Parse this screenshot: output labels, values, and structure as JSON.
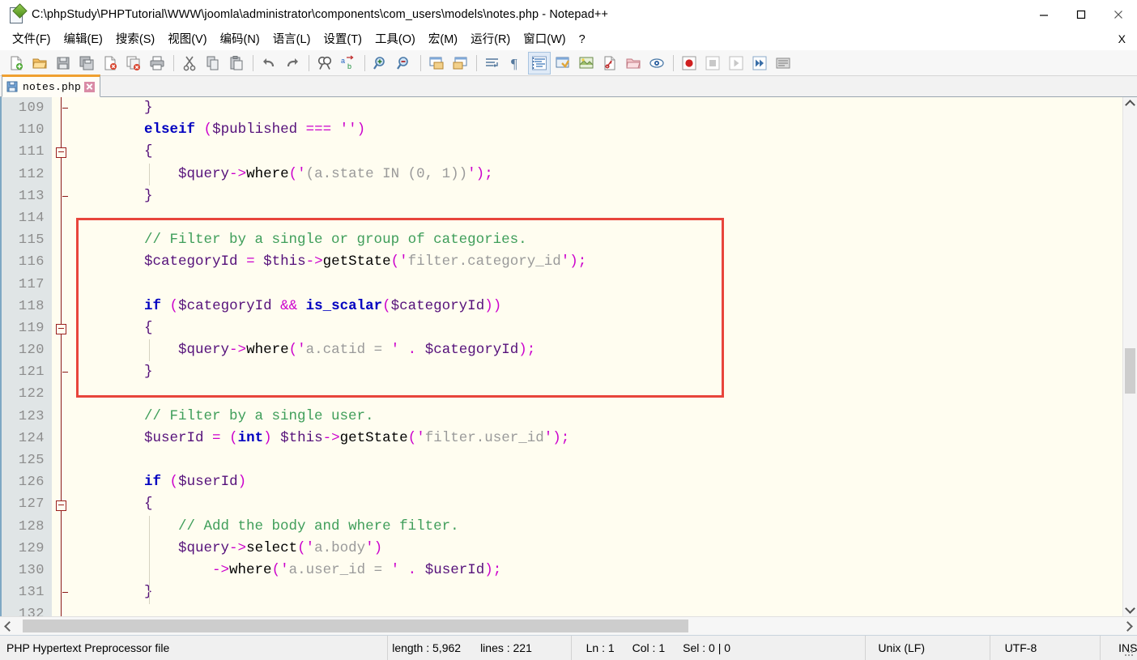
{
  "window": {
    "title": "C:\\phpStudy\\PHPTutorial\\WWW\\joomla\\administrator\\components\\com_users\\models\\notes.php - Notepad++",
    "icon": "notepadpp-document-icon",
    "controls": {
      "minimize": "minimize-icon",
      "maximize": "maximize-icon",
      "close": "close-icon"
    }
  },
  "menubar": {
    "items": [
      {
        "label": "文件(F)",
        "name": "menu-file"
      },
      {
        "label": "编辑(E)",
        "name": "menu-edit"
      },
      {
        "label": "搜索(S)",
        "name": "menu-search"
      },
      {
        "label": "视图(V)",
        "name": "menu-view"
      },
      {
        "label": "编码(N)",
        "name": "menu-encoding"
      },
      {
        "label": "语言(L)",
        "name": "menu-language"
      },
      {
        "label": "设置(T)",
        "name": "menu-settings"
      },
      {
        "label": "工具(O)",
        "name": "menu-tools"
      },
      {
        "label": "宏(M)",
        "name": "menu-macro"
      },
      {
        "label": "运行(R)",
        "name": "menu-run"
      },
      {
        "label": "窗口(W)",
        "name": "menu-window"
      },
      {
        "label": "?",
        "name": "menu-help"
      }
    ],
    "close_document": "X"
  },
  "toolbar": {
    "buttons": [
      "new-file-icon",
      "open-file-icon",
      "save-icon",
      "save-all-icon",
      "close-file-icon",
      "close-all-icon",
      "print-icon",
      "cut-icon",
      "copy-icon",
      "paste-icon",
      "undo-icon",
      "redo-icon",
      "find-icon",
      "replace-icon",
      "zoom-in-icon",
      "zoom-out-icon",
      "sync-vertical-scroll-icon",
      "sync-horizontal-scroll-icon",
      "word-wrap-icon",
      "show-all-chars-icon",
      "indent-guide-icon",
      "user-defined-dialog-icon",
      "show-doc-map-icon",
      "function-list-icon",
      "folder-as-workspace-icon",
      "monitoring-icon",
      "macro-record-icon",
      "macro-stop-icon",
      "macro-play-icon",
      "macro-run-multiple-icon",
      "macro-save-icon"
    ]
  },
  "tabs": [
    {
      "label": "notes.php",
      "icon": "saved-file-icon",
      "close": "tab-close-icon",
      "active": true
    }
  ],
  "editor": {
    "first_line": 109,
    "lines": [
      {
        "n": 109,
        "fold": "end",
        "tokens": [
          {
            "t": "        ",
            "c": "n"
          },
          {
            "t": "}",
            "c": "v"
          }
        ]
      },
      {
        "n": 110,
        "fold": "",
        "tokens": [
          {
            "t": "        ",
            "c": "n"
          },
          {
            "t": "elseif",
            "c": "k"
          },
          {
            "t": " ",
            "c": "n"
          },
          {
            "t": "(",
            "c": "p"
          },
          {
            "t": "$published",
            "c": "v"
          },
          {
            "t": " ",
            "c": "n"
          },
          {
            "t": "===",
            "c": "p"
          },
          {
            "t": " ",
            "c": "n"
          },
          {
            "t": "''",
            "c": "p"
          },
          {
            "t": ")",
            "c": "p"
          }
        ]
      },
      {
        "n": 111,
        "fold": "box",
        "tokens": [
          {
            "t": "        ",
            "c": "n"
          },
          {
            "t": "{",
            "c": "v"
          }
        ]
      },
      {
        "n": 112,
        "fold": "",
        "tokens": [
          {
            "t": "            ",
            "c": "n"
          },
          {
            "t": "$query",
            "c": "v"
          },
          {
            "t": "->",
            "c": "p"
          },
          {
            "t": "where",
            "c": "fn"
          },
          {
            "t": "(",
            "c": "p"
          },
          {
            "t": "'",
            "c": "p"
          },
          {
            "t": "(a.state IN (0, 1))",
            "c": "s"
          },
          {
            "t": "'",
            "c": "p"
          },
          {
            "t": ")",
            "c": "p"
          },
          {
            "t": ";",
            "c": "p"
          }
        ]
      },
      {
        "n": 113,
        "fold": "end",
        "tokens": [
          {
            "t": "        ",
            "c": "n"
          },
          {
            "t": "}",
            "c": "v"
          }
        ]
      },
      {
        "n": 114,
        "fold": "",
        "tokens": []
      },
      {
        "n": 115,
        "fold": "",
        "tokens": [
          {
            "t": "        ",
            "c": "n"
          },
          {
            "t": "// Filter by a single or group of categories.",
            "c": "c"
          }
        ]
      },
      {
        "n": 116,
        "fold": "",
        "tokens": [
          {
            "t": "        ",
            "c": "n"
          },
          {
            "t": "$categoryId",
            "c": "v"
          },
          {
            "t": " ",
            "c": "n"
          },
          {
            "t": "=",
            "c": "p"
          },
          {
            "t": " ",
            "c": "n"
          },
          {
            "t": "$this",
            "c": "v"
          },
          {
            "t": "->",
            "c": "p"
          },
          {
            "t": "getState",
            "c": "fn"
          },
          {
            "t": "(",
            "c": "p"
          },
          {
            "t": "'",
            "c": "p"
          },
          {
            "t": "filter.category_id",
            "c": "s"
          },
          {
            "t": "'",
            "c": "p"
          },
          {
            "t": ")",
            "c": "p"
          },
          {
            "t": ";",
            "c": "p"
          }
        ]
      },
      {
        "n": 117,
        "fold": "",
        "tokens": []
      },
      {
        "n": 118,
        "fold": "",
        "tokens": [
          {
            "t": "        ",
            "c": "n"
          },
          {
            "t": "if",
            "c": "k"
          },
          {
            "t": " ",
            "c": "n"
          },
          {
            "t": "(",
            "c": "p"
          },
          {
            "t": "$categoryId",
            "c": "v"
          },
          {
            "t": " ",
            "c": "n"
          },
          {
            "t": "&&",
            "c": "p"
          },
          {
            "t": " ",
            "c": "n"
          },
          {
            "t": "is_scalar",
            "c": "k"
          },
          {
            "t": "(",
            "c": "p"
          },
          {
            "t": "$categoryId",
            "c": "v"
          },
          {
            "t": ")",
            "c": "p"
          },
          {
            "t": ")",
            "c": "p"
          }
        ]
      },
      {
        "n": 119,
        "fold": "box",
        "tokens": [
          {
            "t": "        ",
            "c": "n"
          },
          {
            "t": "{",
            "c": "v"
          }
        ]
      },
      {
        "n": 120,
        "fold": "",
        "tokens": [
          {
            "t": "            ",
            "c": "n"
          },
          {
            "t": "$query",
            "c": "v"
          },
          {
            "t": "->",
            "c": "p"
          },
          {
            "t": "where",
            "c": "fn"
          },
          {
            "t": "(",
            "c": "p"
          },
          {
            "t": "'",
            "c": "p"
          },
          {
            "t": "a.catid = ",
            "c": "s"
          },
          {
            "t": "'",
            "c": "p"
          },
          {
            "t": " ",
            "c": "n"
          },
          {
            "t": ".",
            "c": "p"
          },
          {
            "t": " ",
            "c": "n"
          },
          {
            "t": "$categoryId",
            "c": "v"
          },
          {
            "t": ")",
            "c": "p"
          },
          {
            "t": ";",
            "c": "p"
          }
        ]
      },
      {
        "n": 121,
        "fold": "end",
        "tokens": [
          {
            "t": "        ",
            "c": "n"
          },
          {
            "t": "}",
            "c": "v"
          }
        ]
      },
      {
        "n": 122,
        "fold": "",
        "tokens": []
      },
      {
        "n": 123,
        "fold": "",
        "tokens": [
          {
            "t": "        ",
            "c": "n"
          },
          {
            "t": "// Filter by a single user.",
            "c": "c"
          }
        ]
      },
      {
        "n": 124,
        "fold": "",
        "tokens": [
          {
            "t": "        ",
            "c": "n"
          },
          {
            "t": "$userId",
            "c": "v"
          },
          {
            "t": " ",
            "c": "n"
          },
          {
            "t": "=",
            "c": "p"
          },
          {
            "t": " ",
            "c": "n"
          },
          {
            "t": "(",
            "c": "p"
          },
          {
            "t": "int",
            "c": "k"
          },
          {
            "t": ")",
            "c": "p"
          },
          {
            "t": " ",
            "c": "n"
          },
          {
            "t": "$this",
            "c": "v"
          },
          {
            "t": "->",
            "c": "p"
          },
          {
            "t": "getState",
            "c": "fn"
          },
          {
            "t": "(",
            "c": "p"
          },
          {
            "t": "'",
            "c": "p"
          },
          {
            "t": "filter.user_id",
            "c": "s"
          },
          {
            "t": "'",
            "c": "p"
          },
          {
            "t": ")",
            "c": "p"
          },
          {
            "t": ";",
            "c": "p"
          }
        ]
      },
      {
        "n": 125,
        "fold": "",
        "tokens": []
      },
      {
        "n": 126,
        "fold": "",
        "tokens": [
          {
            "t": "        ",
            "c": "n"
          },
          {
            "t": "if",
            "c": "k"
          },
          {
            "t": " ",
            "c": "n"
          },
          {
            "t": "(",
            "c": "p"
          },
          {
            "t": "$userId",
            "c": "v"
          },
          {
            "t": ")",
            "c": "p"
          }
        ]
      },
      {
        "n": 127,
        "fold": "box",
        "tokens": [
          {
            "t": "        ",
            "c": "n"
          },
          {
            "t": "{",
            "c": "v"
          }
        ]
      },
      {
        "n": 128,
        "fold": "",
        "tokens": [
          {
            "t": "            ",
            "c": "n"
          },
          {
            "t": "// Add the body and where filter.",
            "c": "c"
          }
        ]
      },
      {
        "n": 129,
        "fold": "",
        "tokens": [
          {
            "t": "            ",
            "c": "n"
          },
          {
            "t": "$query",
            "c": "v"
          },
          {
            "t": "->",
            "c": "p"
          },
          {
            "t": "select",
            "c": "fn"
          },
          {
            "t": "(",
            "c": "p"
          },
          {
            "t": "'",
            "c": "p"
          },
          {
            "t": "a.body",
            "c": "s"
          },
          {
            "t": "'",
            "c": "p"
          },
          {
            "t": ")",
            "c": "p"
          }
        ]
      },
      {
        "n": 130,
        "fold": "",
        "tokens": [
          {
            "t": "                ",
            "c": "n"
          },
          {
            "t": "->",
            "c": "p"
          },
          {
            "t": "where",
            "c": "fn"
          },
          {
            "t": "(",
            "c": "p"
          },
          {
            "t": "'",
            "c": "p"
          },
          {
            "t": "a.user_id = ",
            "c": "s"
          },
          {
            "t": "'",
            "c": "p"
          },
          {
            "t": " ",
            "c": "n"
          },
          {
            "t": ".",
            "c": "p"
          },
          {
            "t": " ",
            "c": "n"
          },
          {
            "t": "$userId",
            "c": "v"
          },
          {
            "t": ")",
            "c": "p"
          },
          {
            "t": ";",
            "c": "p"
          }
        ]
      },
      {
        "n": 131,
        "fold": "end",
        "tokens": [
          {
            "t": "        ",
            "c": "n"
          },
          {
            "t": "}",
            "c": "v"
          }
        ]
      },
      {
        "n": 132,
        "fold": "",
        "tokens": []
      }
    ],
    "annotation": {
      "name": "red-highlight-box",
      "color": "#e8453c",
      "covers_lines": "115-122"
    }
  },
  "scrollbars": {
    "vertical": {
      "up": "scroll-up-icon",
      "down": "scroll-down-icon"
    },
    "horizontal": {
      "left": "scroll-left-icon",
      "right": "scroll-right-icon"
    }
  },
  "statusbar": {
    "doctype": "PHP Hypertext Preprocessor file",
    "length_label": "length : 5,962",
    "lines_label": "lines : 221",
    "ln": "Ln : 1",
    "col": "Col : 1",
    "sel": "Sel : 0 | 0",
    "eol": "Unix (LF)",
    "encoding": "UTF-8",
    "insert_mode": "INS"
  },
  "colors": {
    "keyword": "#0000c0",
    "variable": "#55107a",
    "operator": "#cc00cc",
    "string": "#9a9a9a",
    "comment": "#3f9e5a",
    "editor_bg": "#fffdf0",
    "gutter_bg": "#e0e5e6",
    "tab_accent": "#f0a030",
    "annotation": "#e8453c"
  }
}
